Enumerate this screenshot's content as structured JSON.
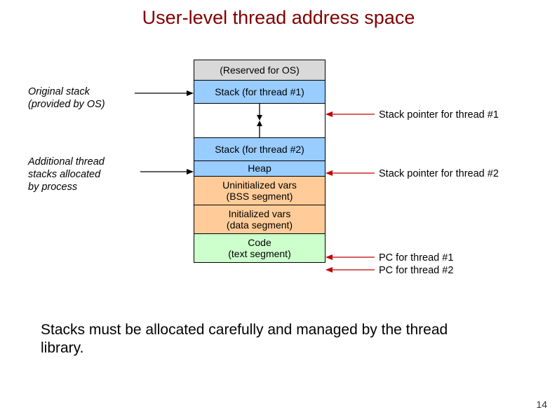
{
  "title": "User-level thread address space",
  "segments": {
    "reserved": "(Reserved for OS)",
    "stack1": "Stack (for thread #1)",
    "stack2": "Stack (for thread #2)",
    "heap": "Heap",
    "bss_l1": "Uninitialized vars",
    "bss_l2": "(BSS segment)",
    "data_l1": "Initialized vars",
    "data_l2": "(data segment)",
    "code_l1": "Code",
    "code_l2": "(text segment)"
  },
  "left_labels": {
    "orig_l1": "Original stack",
    "orig_l2": "(provided by OS)",
    "add_l1": "Additional thread",
    "add_l2": "stacks allocated",
    "add_l3": "by process"
  },
  "right_labels": {
    "sp1": "Stack pointer for thread #1",
    "sp2": "Stack pointer for thread #2",
    "pc1": "PC for thread #1",
    "pc2": "PC for thread #2"
  },
  "footer": "Stacks must be allocated carefully and managed by the thread library.",
  "page_number": "14"
}
